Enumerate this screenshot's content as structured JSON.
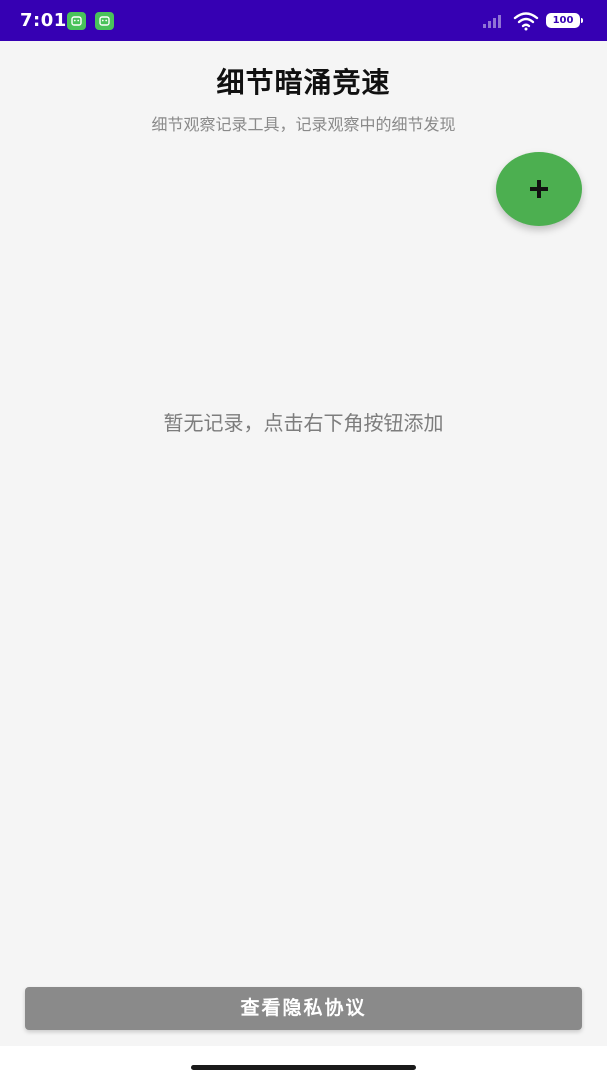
{
  "status_bar": {
    "time": "7:01",
    "battery": "100",
    "background_color": "#3600b3",
    "icons": [
      "android-notification-icon",
      "android-notification-icon",
      "signal-icon",
      "wifi-icon",
      "battery-icon"
    ]
  },
  "header": {
    "title": "细节暗涌竞速",
    "subtitle": "细节观察记录工具，记录观察中的细节发现"
  },
  "fab": {
    "icon": "plus-icon",
    "color": "#4caf50"
  },
  "empty_state": {
    "message": "暂无记录，点击右下角按钮添加"
  },
  "footer": {
    "privacy_button_label": "查看隐私协议",
    "button_color": "#8a8a8a"
  }
}
